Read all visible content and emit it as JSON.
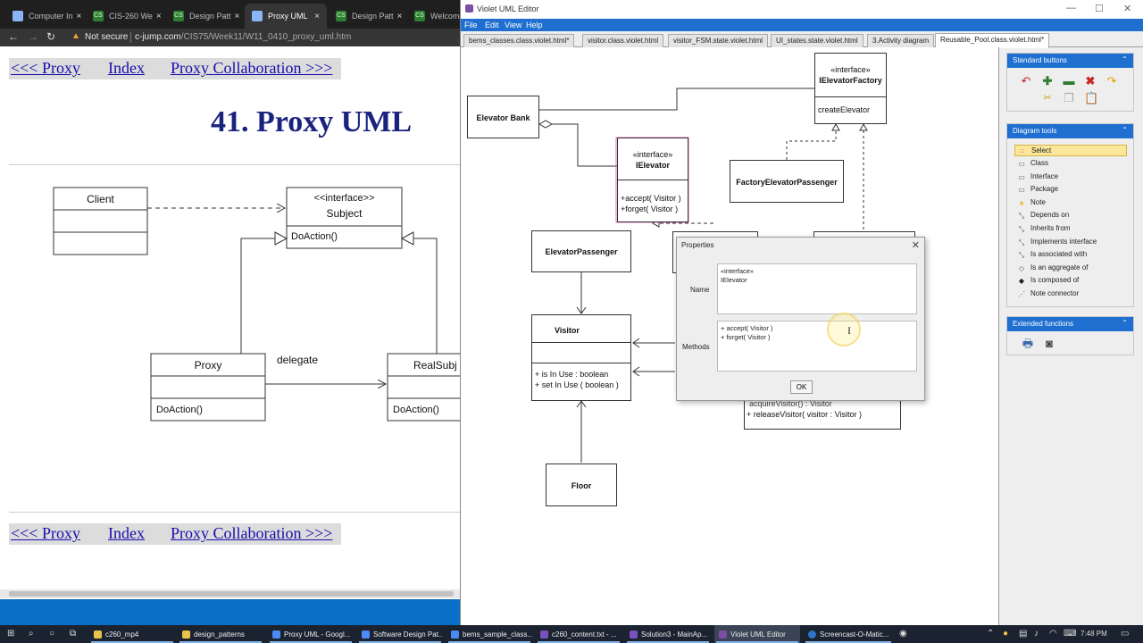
{
  "browser": {
    "tabs": [
      {
        "label": "Computer In"
      },
      {
        "label": "CIS-260 We"
      },
      {
        "label": "Design Patt"
      },
      {
        "label": "Proxy UML"
      },
      {
        "label": "Design Patt"
      },
      {
        "label": "Welcome t"
      }
    ],
    "address": {
      "security": "Not secure",
      "url_host": "c-jump.com",
      "url_path": "/CIS75/Week11/W11_0410_proxy_uml.htm"
    },
    "page": {
      "nav_prev": "<<< Proxy",
      "nav_index": "Index",
      "nav_next": "Proxy Collaboration >>>",
      "heading": "41. Proxy UML",
      "diagram": {
        "client": "Client",
        "subject_stereotype": "<<interface>>",
        "subject_name": "Subject",
        "subject_method": "DoAction()",
        "proxy": "Proxy",
        "proxy_method": "DoAction()",
        "real_subject": "RealSubj",
        "real_method": "DoAction()",
        "delegate": "delegate"
      }
    }
  },
  "violet": {
    "title": "Violet UML Editor",
    "menu": [
      "File",
      "Edit",
      "View",
      "Help"
    ],
    "tabs": [
      "bems_classes.class.violet.html*",
      "visitor.class.violet.html",
      "visitor_FSM.state.violet.html",
      "UI_states.state.violet.html",
      "3.Activity diagram",
      "Reusable_Pool.class.violet.html*"
    ],
    "diagram": {
      "elevator_bank": "Elevator Bank",
      "factory_stereotype": "«interface»",
      "factory_name": "IElevatorFactory",
      "factory_method": "createElevator",
      "ielevator_stereotype": "«interface»",
      "ielevator_name": "IElevator",
      "ielevator_m1": "+accept( Visitor )",
      "ielevator_m2": "+forget( Visitor )",
      "factory_passenger": "FactoryElevatorPassenger",
      "elevator_passenger": "ElevatorPassenger",
      "visitor": "Visitor",
      "visitor_m1": "+ is In Use : boolean",
      "visitor_m2": "+ set In Use ( boolean )",
      "floor": "Floor",
      "pool_m1": "acquireVisitor() : Visitor",
      "pool_m2": "+ releaseVisitor( visitor : Visitor )"
    },
    "properties": {
      "title": "Properties",
      "name_label": "Name",
      "name_value": "«interface»\nIElevator",
      "methods_label": "Methods",
      "methods_value": "+ accept( Visitor )\n+ forget( Visitor )",
      "ok": "OK"
    },
    "panels": {
      "standard": "Standard buttons",
      "tools_title": "Diagram tools",
      "tools": [
        "Select",
        "Class",
        "Interface",
        "Package",
        "Note",
        "Depends on",
        "Inherits from",
        "Implements interface",
        "Is associated with",
        "Is an aggregate of",
        "Is composed of",
        "Note connector"
      ],
      "extended": "Extended functions"
    }
  },
  "taskbar": {
    "items": [
      "c260_mp4",
      "design_patterns",
      "Proxy UML - Googl...",
      "Software Design Pat...",
      "bems_sample_class...",
      "c260_content.txt - ...",
      "Solution3 - MainAp...",
      "Violet UML Editor",
      "Screencast-O-Matic..."
    ],
    "time": "7:48 PM"
  }
}
